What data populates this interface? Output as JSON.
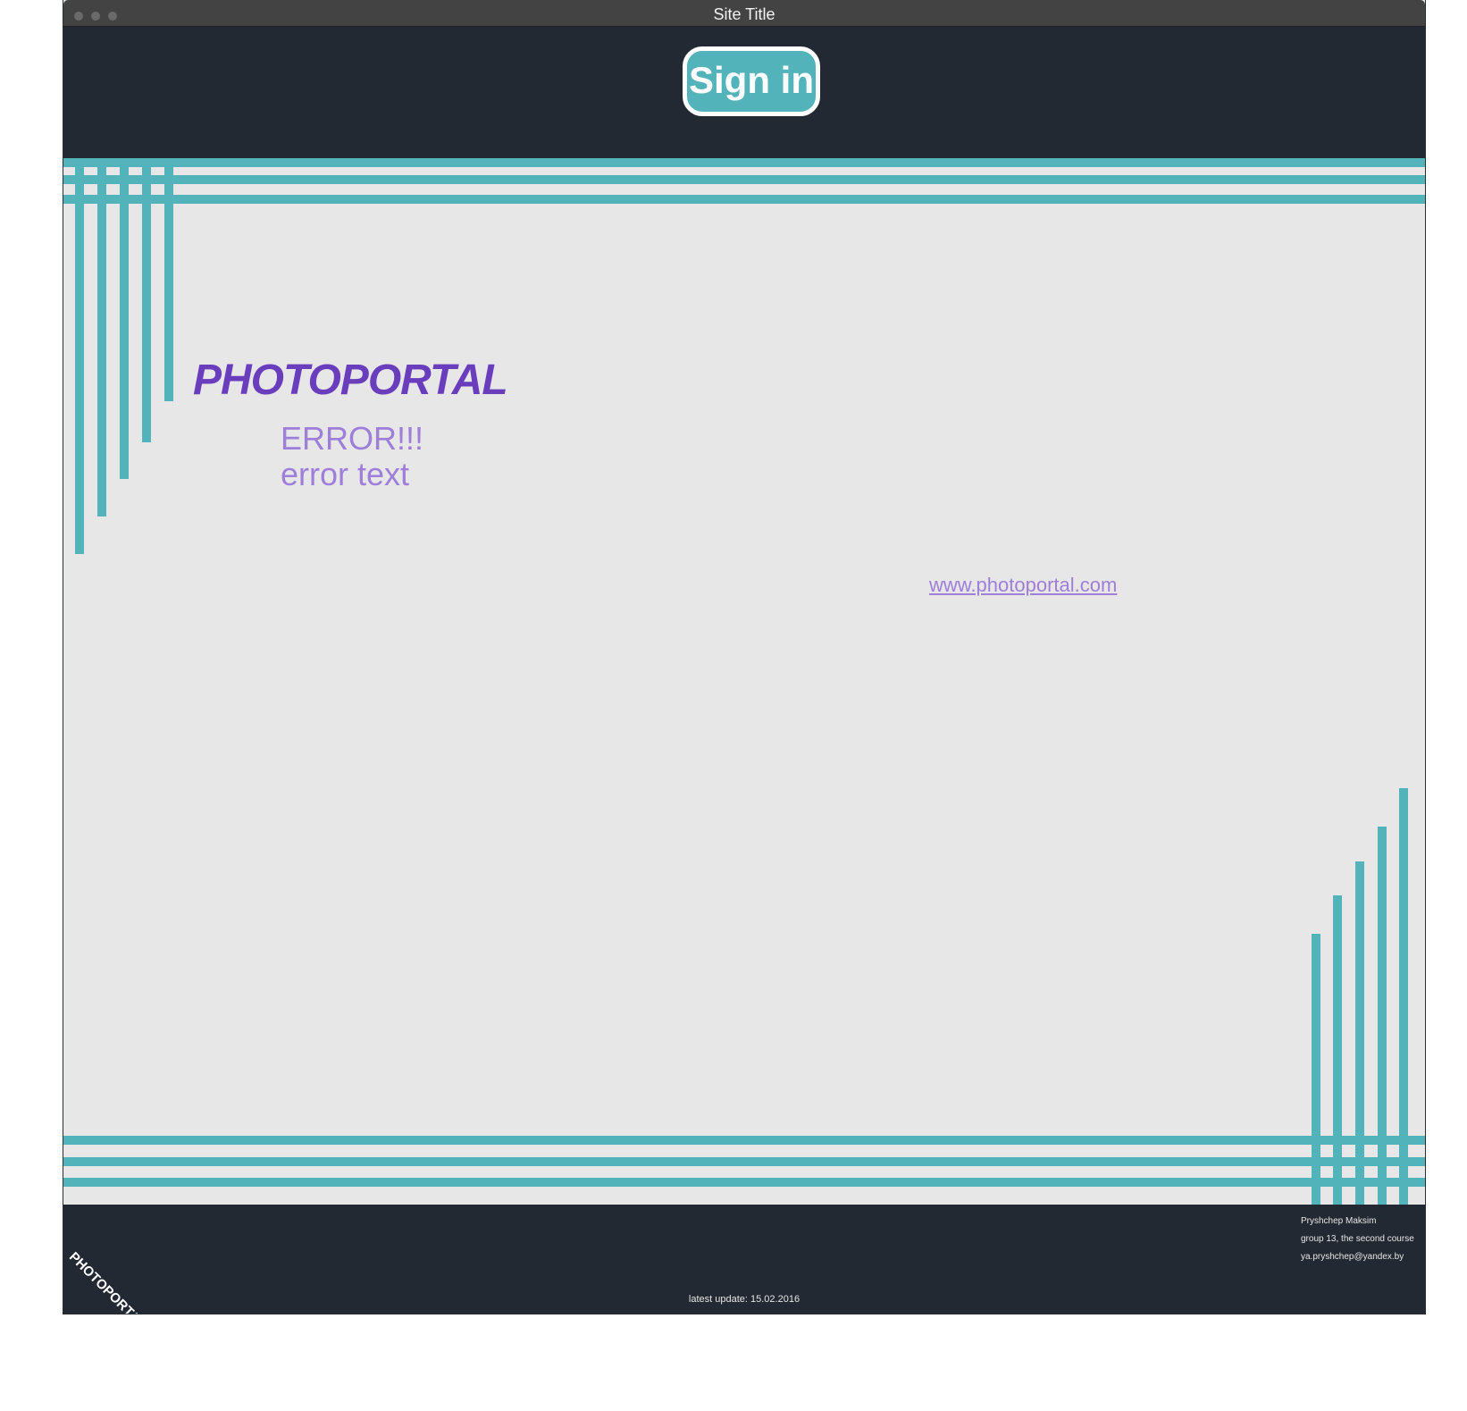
{
  "window": {
    "title": "Site Title"
  },
  "header": {
    "signin_label": "Sign in"
  },
  "main": {
    "logo": "PHOTOPORTAL",
    "error_title": "ERROR!!!",
    "error_text": "error text",
    "site_link": "www.photoportal.com"
  },
  "footer": {
    "logo": "PHOTOPORTAL",
    "update": "latest update: 15.02.2016",
    "author": "Pryshchep Maksim",
    "group": "group 13, the second course",
    "email": "ya.pryshchep@yandex.by"
  },
  "colors": {
    "accent": "#52b3ba",
    "dark": "#222932",
    "background": "#e7e7e8",
    "logo_purple": "#6a3dbd",
    "text_purple": "#9e7ed9"
  }
}
